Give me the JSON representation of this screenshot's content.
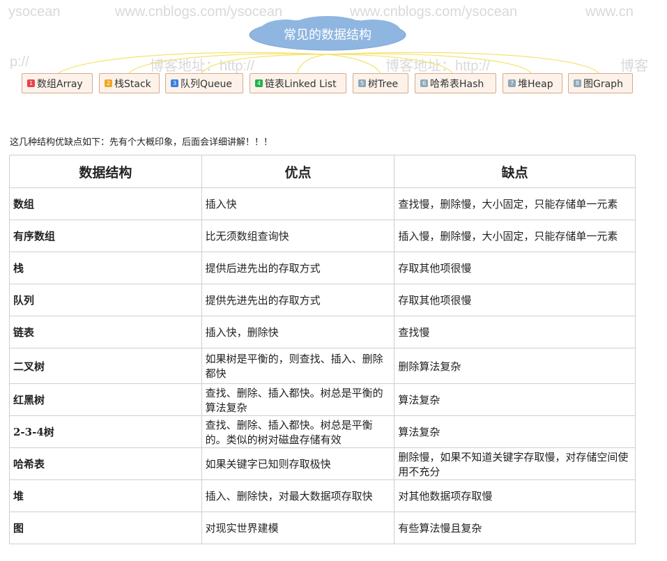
{
  "watermarks": [
    "ysocean",
    "www.cnblogs.com/ysocean",
    "www.cnblogs.com/ysocean",
    "www.cn",
    "p://",
    "博客地址：http://",
    "博客地址：http://",
    "博客"
  ],
  "mindmap": {
    "root": "常见的数据结构",
    "branches": [
      {
        "num": "1",
        "label": "数组Array",
        "color": "#e8424a"
      },
      {
        "num": "2",
        "label": "栈Stack",
        "color": "#f2a623"
      },
      {
        "num": "3",
        "label": "队列Queue",
        "color": "#3a7ee0"
      },
      {
        "num": "4",
        "label": "链表Linked List",
        "color": "#22b14c"
      },
      {
        "num": "5",
        "label": "树Tree",
        "color": "#8fa9b8"
      },
      {
        "num": "6",
        "label": "哈希表Hash",
        "color": "#8fa9b8"
      },
      {
        "num": "7",
        "label": "堆Heap",
        "color": "#8fa9b8"
      },
      {
        "num": "8",
        "label": "图Graph",
        "color": "#8fa9b8"
      }
    ]
  },
  "intro": "这几种结构优缺点如下：先有个大概印象，后面会详细讲解！！！",
  "table": {
    "headers": [
      "数据结构",
      "优点",
      "缺点"
    ],
    "rows": [
      [
        "数组",
        "插入快",
        "查找慢，删除慢，大小固定，只能存储单一元素"
      ],
      [
        "有序数组",
        "比无须数组查询快",
        "插入慢，删除慢，大小固定，只能存储单一元素"
      ],
      [
        "栈",
        "提供后进先出的存取方式",
        "存取其他项很慢"
      ],
      [
        "队列",
        "提供先进先出的存取方式",
        "存取其他项很慢"
      ],
      [
        "链表",
        "插入快，删除快",
        "查找慢"
      ],
      [
        "二叉树",
        "如果树是平衡的，则查找、插入、删除都快",
        "删除算法复杂"
      ],
      [
        "红黑树",
        "查找、删除、插入都快。树总是平衡的算法复杂",
        "算法复杂"
      ],
      [
        "2-3-4树",
        "查找、删除、插入都快。树总是平衡的。类似的树对磁盘存储有效",
        "算法复杂"
      ],
      [
        "哈希表",
        "如果关键字已知则存取极快",
        "删除慢，如果不知道关键字存取慢，对存储空间使用不充分"
      ],
      [
        "堆",
        "插入、删除快，对最大数据项存取快",
        "对其他数据项存取慢"
      ],
      [
        "图",
        "对现实世界建模",
        "有些算法慢且复杂"
      ]
    ]
  }
}
